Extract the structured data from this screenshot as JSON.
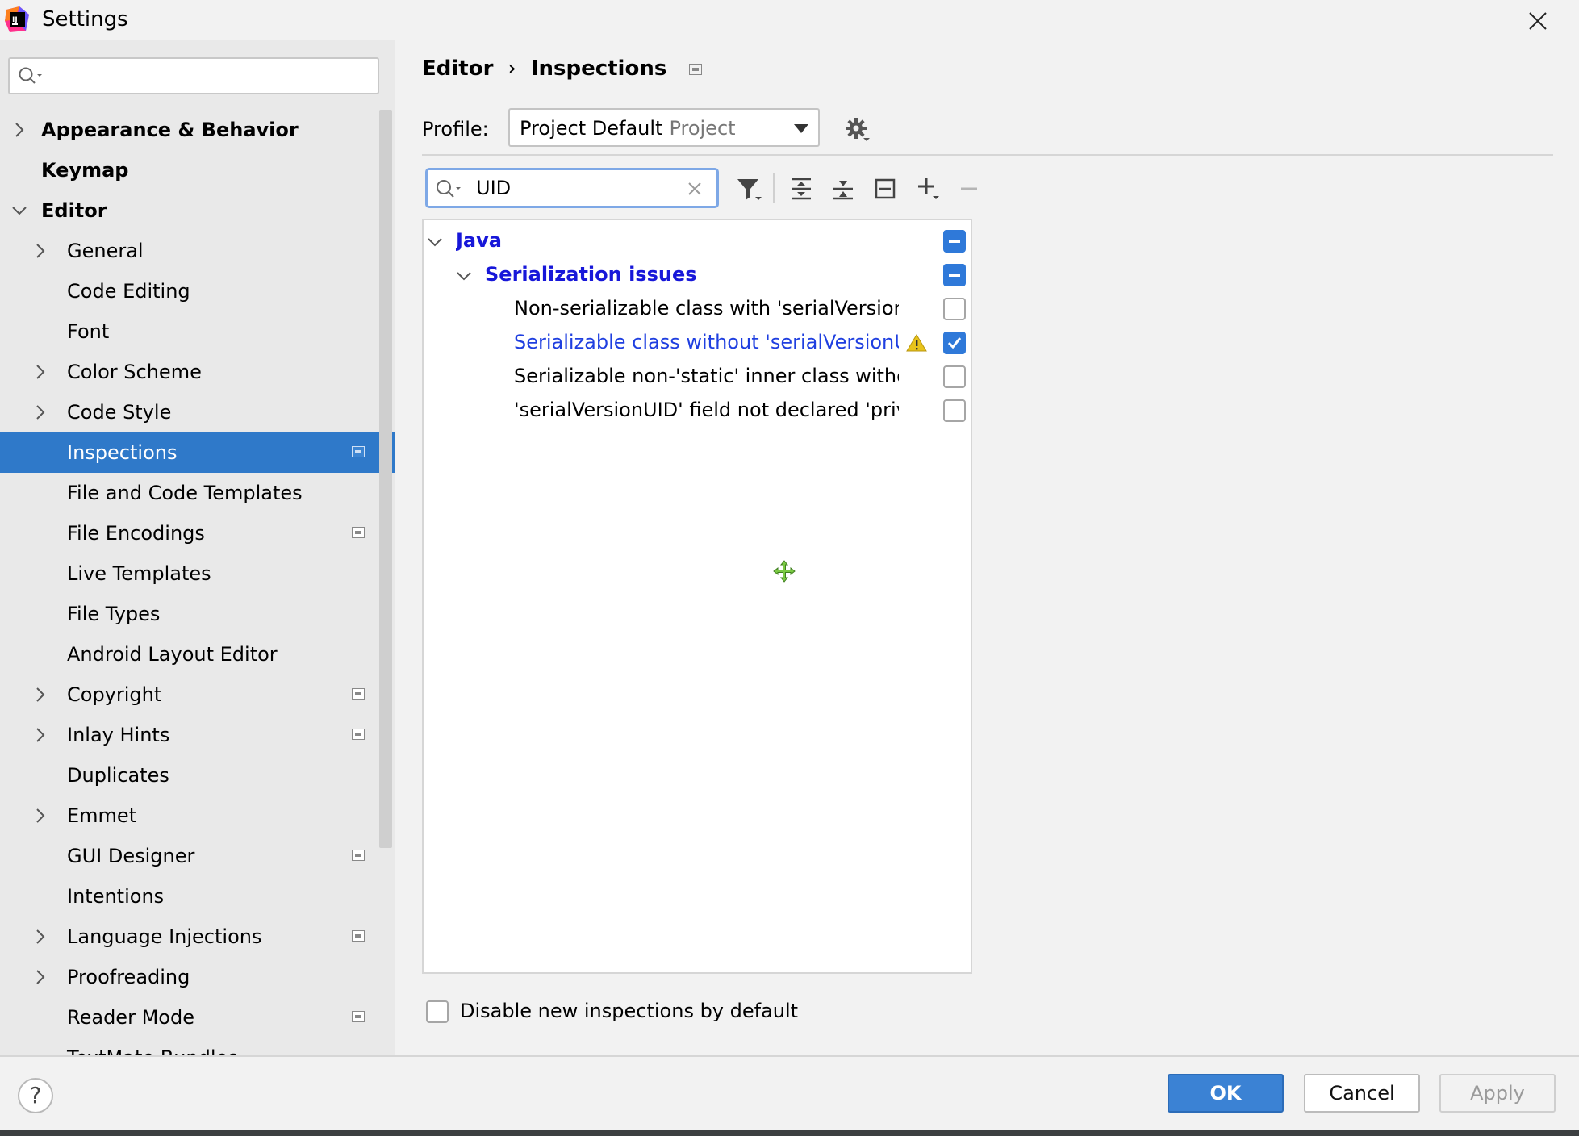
{
  "window": {
    "title": "Settings"
  },
  "sidebar": {
    "search_placeholder": "",
    "items": [
      {
        "label": "Appearance & Behavior",
        "level": 0,
        "expandable": true,
        "expanded": false,
        "bold": true,
        "badge": false,
        "selected": false
      },
      {
        "label": "Keymap",
        "level": 0,
        "expandable": false,
        "expanded": false,
        "bold": true,
        "badge": false,
        "selected": false
      },
      {
        "label": "Editor",
        "level": 0,
        "expandable": true,
        "expanded": true,
        "bold": true,
        "badge": false,
        "selected": false
      },
      {
        "label": "General",
        "level": 1,
        "expandable": true,
        "expanded": false,
        "bold": false,
        "badge": false,
        "selected": false
      },
      {
        "label": "Code Editing",
        "level": 1,
        "expandable": false,
        "expanded": false,
        "bold": false,
        "badge": false,
        "selected": false
      },
      {
        "label": "Font",
        "level": 1,
        "expandable": false,
        "expanded": false,
        "bold": false,
        "badge": false,
        "selected": false
      },
      {
        "label": "Color Scheme",
        "level": 1,
        "expandable": true,
        "expanded": false,
        "bold": false,
        "badge": false,
        "selected": false
      },
      {
        "label": "Code Style",
        "level": 1,
        "expandable": true,
        "expanded": false,
        "bold": false,
        "badge": false,
        "selected": false
      },
      {
        "label": "Inspections",
        "level": 1,
        "expandable": false,
        "expanded": false,
        "bold": false,
        "badge": true,
        "selected": true
      },
      {
        "label": "File and Code Templates",
        "level": 1,
        "expandable": false,
        "expanded": false,
        "bold": false,
        "badge": false,
        "selected": false
      },
      {
        "label": "File Encodings",
        "level": 1,
        "expandable": false,
        "expanded": false,
        "bold": false,
        "badge": true,
        "selected": false
      },
      {
        "label": "Live Templates",
        "level": 1,
        "expandable": false,
        "expanded": false,
        "bold": false,
        "badge": false,
        "selected": false
      },
      {
        "label": "File Types",
        "level": 1,
        "expandable": false,
        "expanded": false,
        "bold": false,
        "badge": false,
        "selected": false
      },
      {
        "label": "Android Layout Editor",
        "level": 1,
        "expandable": false,
        "expanded": false,
        "bold": false,
        "badge": false,
        "selected": false
      },
      {
        "label": "Copyright",
        "level": 1,
        "expandable": true,
        "expanded": false,
        "bold": false,
        "badge": true,
        "selected": false
      },
      {
        "label": "Inlay Hints",
        "level": 1,
        "expandable": true,
        "expanded": false,
        "bold": false,
        "badge": true,
        "selected": false
      },
      {
        "label": "Duplicates",
        "level": 1,
        "expandable": false,
        "expanded": false,
        "bold": false,
        "badge": false,
        "selected": false
      },
      {
        "label": "Emmet",
        "level": 1,
        "expandable": true,
        "expanded": false,
        "bold": false,
        "badge": false,
        "selected": false
      },
      {
        "label": "GUI Designer",
        "level": 1,
        "expandable": false,
        "expanded": false,
        "bold": false,
        "badge": true,
        "selected": false
      },
      {
        "label": "Intentions",
        "level": 1,
        "expandable": false,
        "expanded": false,
        "bold": false,
        "badge": false,
        "selected": false
      },
      {
        "label": "Language Injections",
        "level": 1,
        "expandable": true,
        "expanded": false,
        "bold": false,
        "badge": true,
        "selected": false
      },
      {
        "label": "Proofreading",
        "level": 1,
        "expandable": true,
        "expanded": false,
        "bold": false,
        "badge": false,
        "selected": false
      },
      {
        "label": "Reader Mode",
        "level": 1,
        "expandable": false,
        "expanded": false,
        "bold": false,
        "badge": true,
        "selected": false
      },
      {
        "label": "TextMate Bundles",
        "level": 1,
        "expandable": false,
        "expanded": false,
        "bold": false,
        "badge": false,
        "selected": false
      }
    ]
  },
  "breadcrumb": {
    "parent": "Editor",
    "separator": "›",
    "current": "Inspections"
  },
  "profile": {
    "label": "Profile:",
    "value": "Project Default",
    "scope": "Project"
  },
  "inspection_search": {
    "value": "UID"
  },
  "toolbar": {
    "icons": [
      "filter-icon",
      "expand-all-icon",
      "collapse-all-icon",
      "reset-icon",
      "add-icon",
      "remove-icon"
    ]
  },
  "inspections": [
    {
      "label": "Java",
      "level": 0,
      "group": true,
      "expanded": true,
      "state": "mixed",
      "highlight": false,
      "warning": false
    },
    {
      "label": "Serialization issues",
      "level": 1,
      "group": true,
      "expanded": true,
      "state": "mixed",
      "highlight": false,
      "warning": false
    },
    {
      "label": "Non-serializable class with 'serialVersionUID'",
      "level": 2,
      "group": false,
      "expanded": false,
      "state": "off",
      "highlight": false,
      "warning": false
    },
    {
      "label": "Serializable class without 'serialVersionUID'",
      "level": 2,
      "group": false,
      "expanded": false,
      "state": "on",
      "highlight": true,
      "warning": true
    },
    {
      "label": "Serializable non-'static' inner class without 'serialVersionUID'",
      "level": 2,
      "group": false,
      "expanded": false,
      "state": "off",
      "highlight": false,
      "warning": false
    },
    {
      "label": "'serialVersionUID' field not declared 'private static final long'",
      "level": 2,
      "group": false,
      "expanded": false,
      "state": "off",
      "highlight": false,
      "warning": false
    }
  ],
  "disable_new": {
    "label": "Disable new inspections by default",
    "checked": false
  },
  "footer": {
    "help": "?",
    "ok": "OK",
    "cancel": "Cancel",
    "apply": "Apply"
  },
  "colors": {
    "accent": "#2f79c9",
    "link": "#1717d9",
    "warning": "#e8c31b"
  }
}
